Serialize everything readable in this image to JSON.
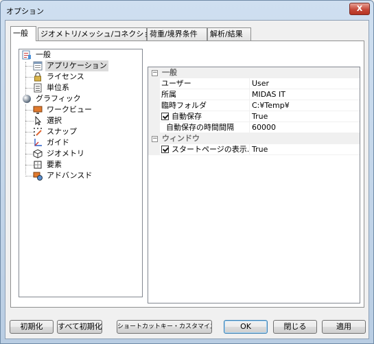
{
  "window": {
    "title": "オプション",
    "close_label": "X"
  },
  "tabs": [
    {
      "label": "一般",
      "active": true
    },
    {
      "label": "ジオメトリ/メッシュ/コネクション",
      "active": false
    },
    {
      "label": "荷重/境界条件",
      "active": false
    },
    {
      "label": "解析/結果",
      "active": false
    }
  ],
  "tree": {
    "items": [
      {
        "label": "一般",
        "icon": "general-settings-icon",
        "level": 0
      },
      {
        "label": "アプリケーション",
        "icon": "application-window-icon",
        "level": 1,
        "selected": true
      },
      {
        "label": "ライセンス",
        "icon": "license-lock-icon",
        "level": 1
      },
      {
        "label": "単位系",
        "icon": "unit-system-document-icon",
        "level": 1
      },
      {
        "label": "グラフィック",
        "icon": "graphics-sphere-icon",
        "level": 0
      },
      {
        "label": "ワークビュー",
        "icon": "work-view-monitor-icon",
        "level": 1
      },
      {
        "label": "選択",
        "icon": "selection-cursor-icon",
        "level": 1
      },
      {
        "label": "スナップ",
        "icon": "snap-icon",
        "level": 1
      },
      {
        "label": "ガイド",
        "icon": "guide-axes-icon",
        "level": 1
      },
      {
        "label": "ジオメトリ",
        "icon": "geometry-cube-icon",
        "level": 1
      },
      {
        "label": "要素",
        "icon": "element-icon",
        "level": 1
      },
      {
        "label": "アドバンスド",
        "icon": "advanced-icon",
        "level": 1
      }
    ]
  },
  "property_grid": {
    "categories": [
      {
        "label": "一般",
        "expanded": true,
        "properties": [
          {
            "name": "ユーザー",
            "value": "User"
          },
          {
            "name": "所属",
            "value": "MIDAS IT"
          },
          {
            "name": "臨時フォルダ",
            "value": "C:¥Temp¥"
          },
          {
            "name": "自動保存",
            "value": "True",
            "checkbox": true,
            "checked": true
          },
          {
            "name": "自動保存の時間間隔",
            "value": "60000",
            "indent": true
          }
        ]
      },
      {
        "label": "ウィンドウ",
        "expanded": true,
        "properties": [
          {
            "name": "スタートページの表示...",
            "value": "True",
            "checkbox": true,
            "checked": true
          }
        ]
      }
    ]
  },
  "buttons": {
    "initialize": "初期化",
    "initialize_all": "すべて初期化",
    "shortcut_customize": "ショートカットキー・カスタマイズ",
    "ok": "OK",
    "close": "閉じる",
    "apply": "適用"
  },
  "colors": {
    "title_gradient": "#cfdff0",
    "close_button": "#c6493a",
    "selection": "#dcdcdc",
    "category_bg": "#f0f0f0"
  }
}
